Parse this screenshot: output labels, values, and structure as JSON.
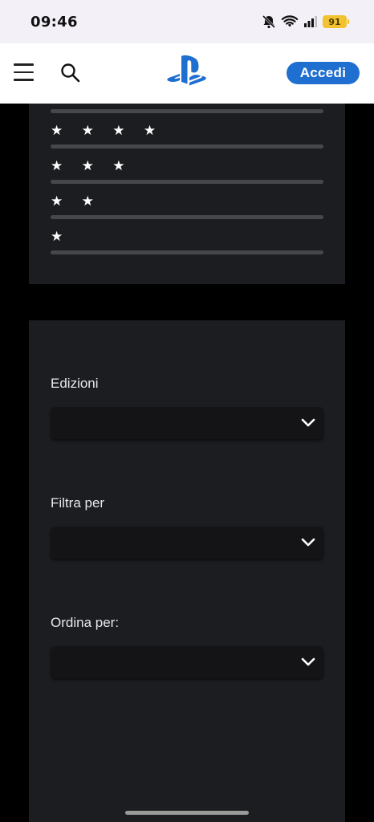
{
  "status_bar": {
    "time": "09:46",
    "battery_level": "91",
    "icons": [
      "bell-muted-icon",
      "wifi-icon",
      "signal-icon",
      "battery-icon"
    ]
  },
  "header": {
    "menu_icon": "hamburger-menu-icon",
    "search_icon": "search-icon",
    "logo": "playstation-logo",
    "signin_label": "Accedi",
    "accent_color": "#1f6fd0"
  },
  "ratings": {
    "rows": [
      {
        "stars": "★ ★ ★ ★"
      },
      {
        "stars": "★ ★ ★"
      },
      {
        "stars": "★ ★"
      },
      {
        "stars": "★"
      }
    ]
  },
  "filters": {
    "editions_label": "Edizioni",
    "editions_value": "",
    "filter_by_label": "Filtra per",
    "filter_by_value": "",
    "sort_by_label": "Ordina per:",
    "sort_by_value": ""
  }
}
